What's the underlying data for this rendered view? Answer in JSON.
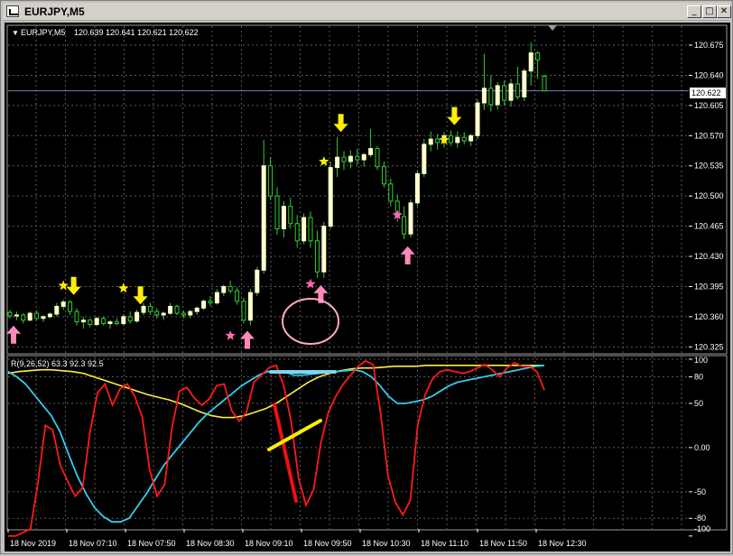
{
  "window": {
    "title": "EURJPY,M5",
    "minimize_glyph": "_",
    "maximize_glyph": "□",
    "close_glyph": "✕"
  },
  "header": {
    "symbol": "EURJPY,M5",
    "ohlc": "120.639 120.641 120.621 120.622",
    "dropdown_glyph": "▼"
  },
  "indicator": {
    "label": "R(9,26,52) 63.3 92.3 92.5"
  },
  "colors": {
    "background": "#000000",
    "grid": "#5a5a5a",
    "bull_candle": "#ffffcc",
    "bull_outline": "#33cc33",
    "bear_candle": "#000000",
    "bear_outline": "#33cc33",
    "buy_arrow": "#ff88bb",
    "sell_arrow": "#ffee00",
    "buy_star": "#ff66b3",
    "sell_star": "#ffee00",
    "current_price_line": "#6e7bbd",
    "red_line": "#ff1a1a",
    "cyan_line": "#33ccee",
    "yellow_line": "#ffee44",
    "annotation_circle": "#ffa8c8",
    "annotation_red": "#ee1111",
    "annotation_yellow": "#ffee00",
    "annotation_blue": "#7fd4f0"
  },
  "chart_data": {
    "type": "candlestick",
    "symbol": "EURJPY",
    "timeframe": "M5",
    "current_price": 120.622,
    "ylim": [
      120.318,
      120.697
    ],
    "y_ticks": [
      "120.675",
      "120.640",
      "120.605",
      "120.570",
      "120.535",
      "120.500",
      "120.465",
      "120.430",
      "120.395",
      "120.360",
      "120.325"
    ],
    "current_price_label": "120.622",
    "x_labels": [
      "18 Nov 2019",
      "18 Nov 07:10",
      "18 Nov 07:50",
      "18 Nov 08:30",
      "18 Nov 09:10",
      "18 Nov 09:50",
      "18 Nov 10:30",
      "18 Nov 11:10",
      "18 Nov 11:50",
      "18 Nov 12:30"
    ],
    "candles": [
      [
        120.365,
        120.368,
        120.358,
        120.361
      ],
      [
        120.361,
        120.366,
        120.356,
        120.362
      ],
      [
        120.362,
        120.364,
        120.352,
        120.356
      ],
      [
        120.356,
        120.366,
        120.355,
        120.364
      ],
      [
        120.364,
        120.367,
        120.356,
        120.358
      ],
      [
        120.358,
        120.362,
        120.354,
        120.36
      ],
      [
        120.36,
        120.365,
        120.358,
        120.363
      ],
      [
        120.363,
        120.376,
        120.36,
        120.372
      ],
      [
        120.372,
        120.38,
        120.368,
        120.377
      ],
      [
        120.377,
        120.379,
        120.362,
        120.366
      ],
      [
        120.366,
        120.37,
        120.35,
        120.354
      ],
      [
        120.354,
        120.36,
        120.346,
        120.356
      ],
      [
        120.356,
        120.358,
        120.348,
        120.351
      ],
      [
        120.351,
        120.36,
        120.349,
        120.358
      ],
      [
        120.358,
        120.36,
        120.35,
        120.352
      ],
      [
        120.352,
        120.356,
        120.346,
        120.354
      ],
      [
        120.354,
        120.358,
        120.35,
        120.352
      ],
      [
        120.352,
        120.363,
        120.35,
        120.36
      ],
      [
        120.36,
        120.366,
        120.352,
        120.355
      ],
      [
        120.355,
        120.368,
        120.353,
        120.365
      ],
      [
        120.365,
        120.376,
        120.362,
        120.372
      ],
      [
        120.372,
        120.376,
        120.362,
        120.366
      ],
      [
        120.366,
        120.37,
        120.358,
        120.362
      ],
      [
        120.362,
        120.366,
        120.356,
        120.364
      ],
      [
        120.364,
        120.376,
        120.362,
        120.372
      ],
      [
        120.372,
        120.374,
        120.362,
        120.364
      ],
      [
        120.364,
        120.367,
        120.358,
        120.362
      ],
      [
        120.362,
        120.368,
        120.358,
        120.366
      ],
      [
        120.366,
        120.372,
        120.362,
        120.37
      ],
      [
        120.37,
        120.38,
        120.368,
        120.378
      ],
      [
        120.378,
        120.384,
        120.372,
        120.376
      ],
      [
        120.376,
        120.392,
        120.374,
        120.388
      ],
      [
        120.388,
        120.397,
        120.384,
        120.395
      ],
      [
        120.395,
        120.402,
        120.387,
        120.39
      ],
      [
        120.39,
        120.394,
        120.374,
        120.378
      ],
      [
        120.378,
        120.382,
        120.352,
        120.356
      ],
      [
        120.356,
        120.392,
        120.35,
        120.388
      ],
      [
        120.388,
        120.418,
        120.384,
        120.414
      ],
      [
        120.414,
        120.565,
        120.41,
        120.535
      ],
      [
        120.535,
        120.545,
        120.495,
        120.5
      ],
      [
        120.5,
        120.51,
        120.455,
        120.462
      ],
      [
        120.462,
        120.494,
        120.452,
        120.488
      ],
      [
        120.488,
        120.498,
        120.462,
        120.468
      ],
      [
        120.468,
        120.478,
        120.44,
        120.448
      ],
      [
        120.448,
        120.48,
        120.444,
        120.475
      ],
      [
        120.475,
        120.482,
        120.44,
        120.448
      ],
      [
        120.448,
        120.46,
        120.405,
        120.412
      ],
      [
        120.412,
        120.47,
        120.405,
        120.465
      ],
      [
        120.465,
        120.54,
        120.462,
        120.533
      ],
      [
        120.533,
        120.568,
        120.522,
        120.545
      ],
      [
        120.545,
        120.552,
        120.53,
        120.54
      ],
      [
        120.54,
        120.553,
        120.532,
        120.546
      ],
      [
        120.546,
        120.555,
        120.536,
        120.542
      ],
      [
        120.542,
        120.55,
        120.534,
        120.548
      ],
      [
        120.548,
        120.578,
        120.545,
        120.555
      ],
      [
        120.555,
        120.558,
        120.53,
        120.534
      ],
      [
        120.534,
        120.54,
        120.51,
        120.514
      ],
      [
        120.514,
        120.52,
        120.488,
        120.494
      ],
      [
        120.494,
        120.502,
        120.47,
        120.476
      ],
      [
        120.476,
        120.488,
        120.45,
        120.456
      ],
      [
        120.456,
        120.496,
        120.452,
        120.492
      ],
      [
        120.492,
        120.53,
        120.488,
        120.526
      ],
      [
        120.526,
        120.566,
        120.522,
        120.56
      ],
      [
        120.56,
        120.575,
        120.552,
        120.566
      ],
      [
        120.566,
        120.572,
        120.554,
        120.562
      ],
      [
        120.562,
        120.574,
        120.556,
        120.57
      ],
      [
        120.57,
        120.576,
        120.558,
        120.562
      ],
      [
        120.562,
        120.575,
        120.556,
        120.568
      ],
      [
        120.568,
        120.574,
        120.56,
        120.564
      ],
      [
        120.564,
        120.572,
        120.558,
        120.57
      ],
      [
        120.57,
        120.612,
        120.566,
        120.608
      ],
      [
        120.608,
        120.665,
        120.6,
        120.625
      ],
      [
        120.625,
        120.64,
        120.598,
        120.606
      ],
      [
        120.606,
        120.632,
        120.6,
        120.628
      ],
      [
        120.628,
        120.634,
        120.605,
        120.611
      ],
      [
        120.611,
        120.636,
        120.604,
        120.63
      ],
      [
        120.63,
        120.65,
        120.612,
        120.615
      ],
      [
        120.615,
        120.648,
        120.61,
        120.645
      ],
      [
        120.645,
        120.678,
        120.628,
        120.666
      ],
      [
        120.666,
        120.668,
        120.636,
        120.658
      ],
      [
        120.639,
        120.641,
        120.621,
        120.622
      ]
    ],
    "buy_arrows": [
      0,
      35,
      46,
      59
    ],
    "sell_arrows": [
      9,
      19,
      49,
      66
    ],
    "buy_stars": [
      {
        "i": 33,
        "price": 120.338
      },
      {
        "i": 45,
        "price": 120.398
      },
      {
        "i": 58,
        "price": 120.478
      }
    ],
    "sell_stars": [
      {
        "i": 8,
        "price": 120.396
      },
      {
        "i": 17,
        "price": 120.393
      },
      {
        "i": 47,
        "price": 120.54
      },
      {
        "i": 65,
        "price": 120.565
      }
    ],
    "indicator": {
      "ylim": [
        -92,
        103
      ],
      "y_ticks": [
        100,
        80,
        50,
        0,
        -50,
        -80,
        -100
      ],
      "red": [
        -100,
        -100,
        -96,
        -92,
        -40,
        25,
        20,
        -20,
        -38,
        -55,
        -45,
        18,
        62,
        72,
        48,
        66,
        72,
        58,
        35,
        -25,
        -55,
        -42,
        22,
        64,
        68,
        56,
        48,
        55,
        70,
        72,
        42,
        30,
        40,
        74,
        82,
        90,
        93,
        70,
        30,
        -35,
        -65,
        -48,
        6,
        40,
        58,
        72,
        82,
        92,
        98,
        94,
        40,
        -32,
        -62,
        -76,
        -60,
        26,
        60,
        78,
        86,
        88,
        86,
        84,
        86,
        90,
        94,
        88,
        80,
        90,
        96,
        92,
        92,
        86,
        65
      ],
      "cyan": [
        86,
        80,
        72,
        60,
        48,
        36,
        18,
        -8,
        -32,
        -52,
        -68,
        -78,
        -84,
        -84,
        -80,
        -66,
        -52,
        -36,
        -20,
        -8,
        4,
        16,
        28,
        38,
        46,
        54,
        62,
        70,
        76,
        82,
        86,
        86,
        86,
        82,
        82,
        83,
        84,
        85,
        86,
        87,
        88,
        86,
        80,
        70,
        58,
        50,
        50,
        52,
        54,
        58,
        64,
        70,
        74,
        76,
        78,
        80,
        82,
        84,
        86,
        88,
        90,
        92,
        93
      ],
      "yellow": [
        84,
        86,
        87,
        88,
        88,
        87,
        86,
        84,
        80,
        76,
        72,
        68,
        64,
        60,
        57,
        54,
        50,
        45,
        40,
        36,
        34,
        34,
        36,
        40,
        44,
        50,
        58,
        66,
        74,
        80,
        84,
        87,
        89,
        90,
        90,
        91,
        92,
        92,
        92,
        93,
        93,
        93,
        93,
        93,
        93,
        93,
        93,
        93,
        93,
        93,
        93
      ],
      "labels": {
        "red": "63.3",
        "cyan": "92.3",
        "yellow": "92.5"
      }
    }
  }
}
